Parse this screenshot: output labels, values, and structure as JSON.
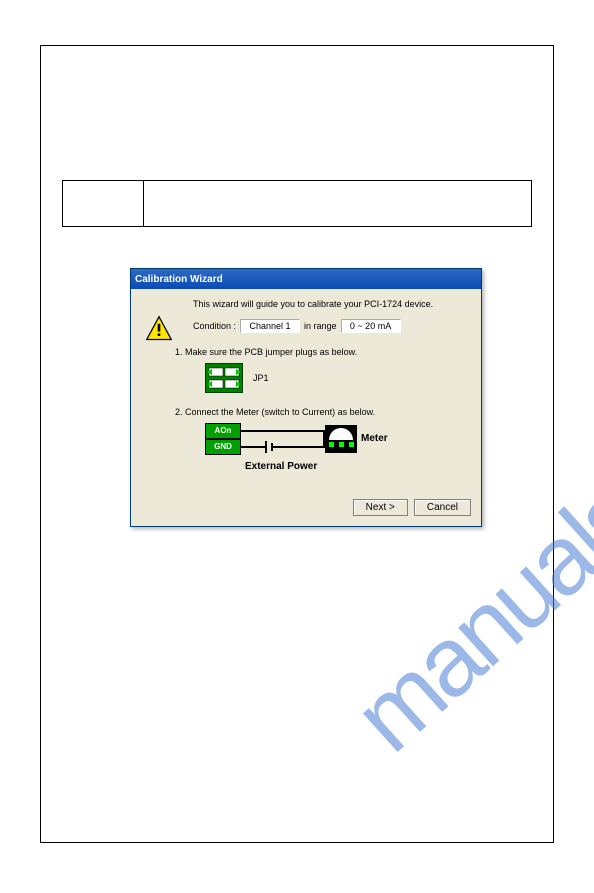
{
  "watermark": "manualshive.com",
  "dialog": {
    "title": "Calibration Wizard",
    "intro": "This wizard will guide you to calibrate your PCI-1724 device.",
    "condition_label": "Condition :",
    "condition_value": "Channel 1",
    "range_label": "in range",
    "range_value": "0 ~ 20 mA",
    "step1": "1. Make sure the PCB jumper plugs as below.",
    "jp1": "JP1",
    "step2": "2. Connect the Meter (switch to Current) as below.",
    "aon": "AOn",
    "gnd": "GND",
    "external_power": "External Power",
    "meter": "Meter",
    "next": "Next >",
    "cancel": "Cancel"
  }
}
